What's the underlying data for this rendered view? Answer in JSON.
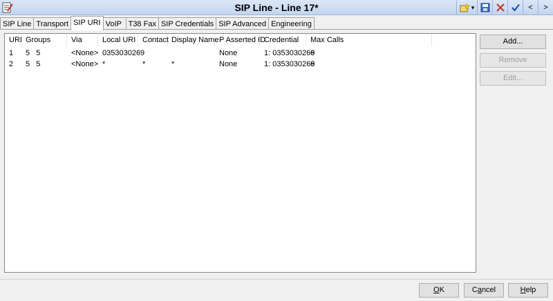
{
  "window": {
    "title": "SIP Line - Line 17*",
    "app_icon": "edit-document-icon",
    "toolbar": {
      "new_icon": "new-item-icon",
      "menu_arrow": "▾",
      "save_icon": "save-icon",
      "delete_icon": "delete-x-icon",
      "ok_icon": "checkmark-icon",
      "prev": "<",
      "next": ">"
    }
  },
  "tabs": [
    {
      "label": "SIP Line"
    },
    {
      "label": "Transport"
    },
    {
      "label": "SIP URI"
    },
    {
      "label": "VoIP"
    },
    {
      "label": "T38 Fax"
    },
    {
      "label": "SIP Credentials"
    },
    {
      "label": "SIP Advanced"
    },
    {
      "label": "Engineering"
    }
  ],
  "active_tab": "SIP URI",
  "table": {
    "columns": [
      "URI",
      "Groups",
      "Via",
      "Local URI",
      "Contact",
      "Display Name",
      "P Asserted ID",
      "Credential",
      "Max Calls"
    ],
    "rows": [
      [
        "1",
        "5   5",
        "<None>",
        "0353030269",
        "",
        "",
        "None",
        "1: 0353030269",
        "6"
      ],
      [
        "2",
        "5   5",
        "<None>",
        "*",
        "*",
        "*",
        "None",
        "1: 0353030269",
        "6"
      ]
    ]
  },
  "side_buttons": {
    "add": "Add...",
    "remove": "Remove",
    "edit": "Edit..."
  },
  "bottom_buttons": {
    "ok_underline": "O",
    "ok_rest": "K",
    "cancel_first": "C",
    "cancel_underline": "a",
    "cancel_rest": "ncel",
    "help_underline": "H",
    "help_rest": "elp"
  }
}
